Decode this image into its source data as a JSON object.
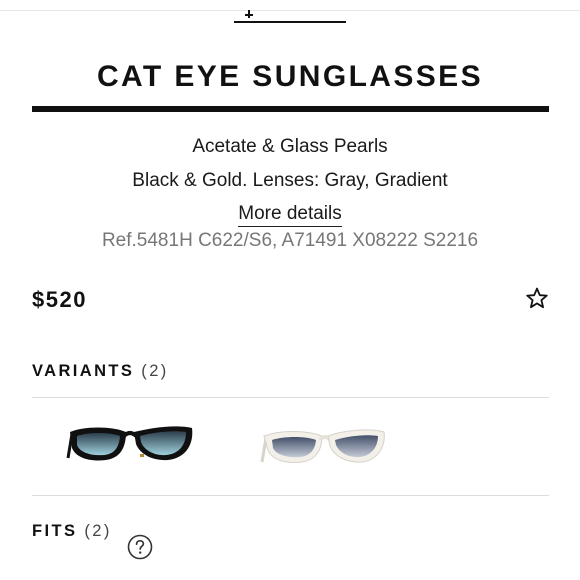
{
  "product": {
    "title": "CAT EYE SUNGLASSES",
    "material": "Acetate & Glass Pearls",
    "colors": "Black & Gold. Lenses: Gray, Gradient",
    "more_details_label": "More details",
    "reference": "Ref.5481H C622/S6, A71491 X08222 S2216",
    "price": "$520"
  },
  "variants": {
    "label": "VARIANTS",
    "count": "(2)",
    "items": [
      {
        "name": "Black",
        "frame_color": "#111111",
        "lens_color": "#6fa3b4"
      },
      {
        "name": "White",
        "frame_color": "#f3f0ea",
        "lens_color": "#5f6f86"
      }
    ]
  },
  "fits": {
    "label": "FITS",
    "count": "(2)"
  },
  "icons": {
    "wishlist": "star-outline-icon",
    "help": "question-circle-icon"
  }
}
